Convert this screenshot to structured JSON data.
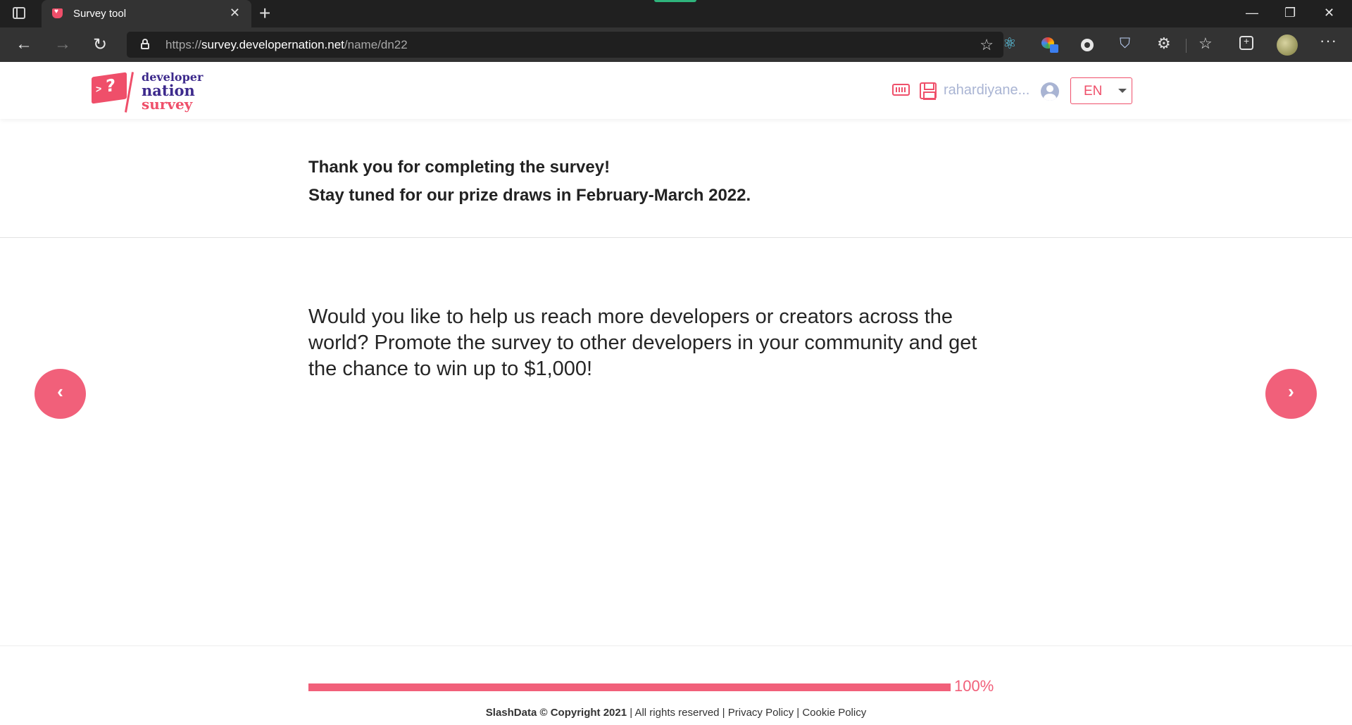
{
  "browser": {
    "tab_title": "Survey tool",
    "tab_close": "✕",
    "new_tab": "+",
    "url_scheme": "https://",
    "url_host": "survey.developernation.net",
    "url_path": "/name/dn22",
    "window_controls": {
      "minimize": "—",
      "restore": "❐",
      "close": "✕"
    },
    "nav": {
      "back": "←",
      "forward": "→",
      "reload": "↻"
    },
    "more": "···",
    "icons": [
      "tab-actions-icon",
      "lock-icon",
      "add-favorite-icon",
      "react-devtools-icon",
      "color-picker-icon",
      "extension-circle-icon",
      "shield-icon",
      "extensions-icon",
      "favorites-icon",
      "collections-icon",
      "profile-avatar"
    ]
  },
  "header": {
    "logo": {
      "line1": "developer",
      "line2": "nation",
      "line3": "survey"
    },
    "username": "rahardiyane...",
    "language": "EN",
    "icons": [
      "keyboard-icon",
      "save-icon",
      "user-icon",
      "chevron-down-icon"
    ]
  },
  "main": {
    "thanks_line1": "Thank you for completing the survey!",
    "thanks_line2": "Stay tuned for our prize draws in February-March 2022.",
    "question": "Would you like to help us reach more developers or creators across the world? Promote the survey to other developers in your community and get the chance to win up to $1,000!",
    "prev_label": "‹",
    "next_label": "›"
  },
  "progress": {
    "value": 100,
    "label": "100%"
  },
  "footer": {
    "brand": "SlashData © Copyright 2021",
    "rights": " | All rights reserved | ",
    "privacy": "Privacy Policy",
    "sep": " | ",
    "cookie": "Cookie Policy"
  },
  "colors": {
    "accent": "#f1607a",
    "brand_purple": "#3d2a8c",
    "muted_user": "#a9b4d3"
  }
}
